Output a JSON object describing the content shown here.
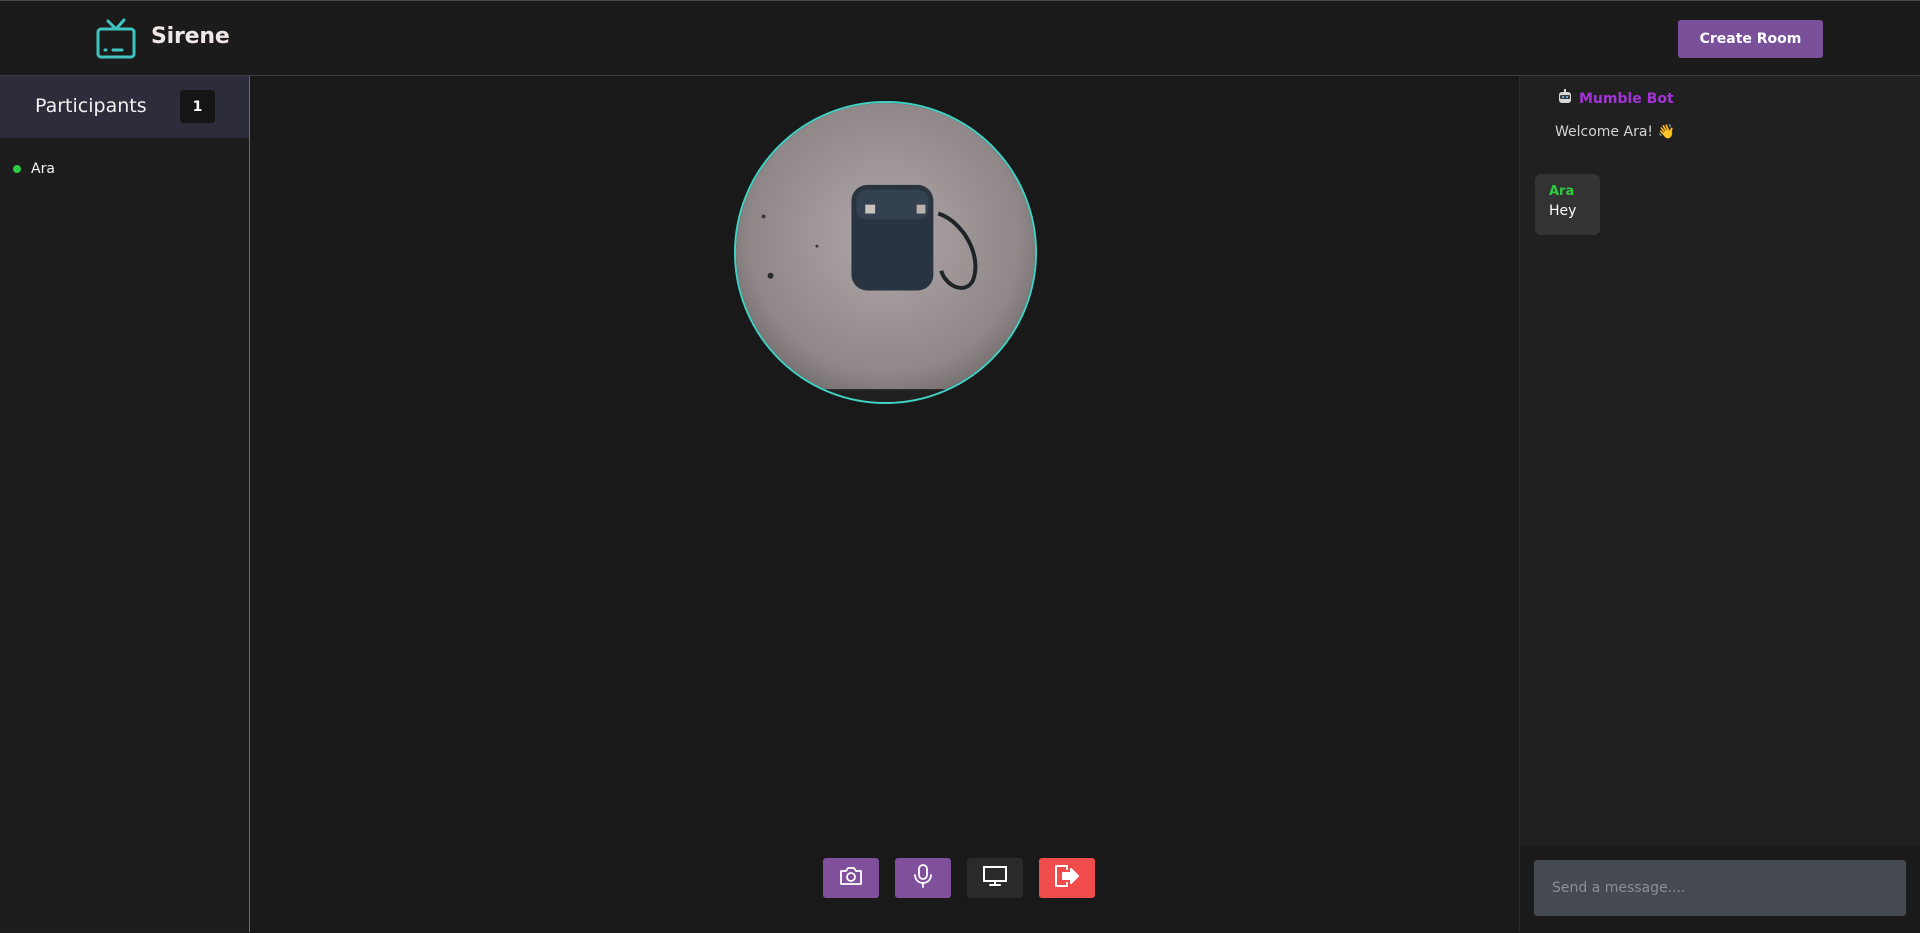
{
  "header": {
    "brand": "Sirene",
    "create_room_label": "Create Room"
  },
  "sidebar": {
    "title": "Participants",
    "count": "1",
    "participants": [
      {
        "name": "Ara",
        "status": "online"
      }
    ]
  },
  "stage": {
    "video_active": true,
    "controls": [
      {
        "name": "camera",
        "icon": "camera-icon",
        "color": "#80509c"
      },
      {
        "name": "microphone",
        "icon": "microphone-icon",
        "color": "#80509c"
      },
      {
        "name": "screen-share",
        "icon": "monitor-icon",
        "color": "#2a2a2a"
      },
      {
        "name": "leave",
        "icon": "leave-icon",
        "color": "#f04c4c"
      }
    ]
  },
  "chat": {
    "bot": {
      "name": "Mumble Bot",
      "icon": "robot-icon",
      "message": "Welcome Ara! 👋"
    },
    "messages": [
      {
        "author": "Ara",
        "text": "Hey"
      }
    ],
    "input_placeholder": "Send a message...."
  },
  "colors": {
    "accent_teal": "#3fd3c4",
    "accent_purple": "#7a509a",
    "online_green": "#2ecc40",
    "leave_red": "#f04c4c"
  }
}
